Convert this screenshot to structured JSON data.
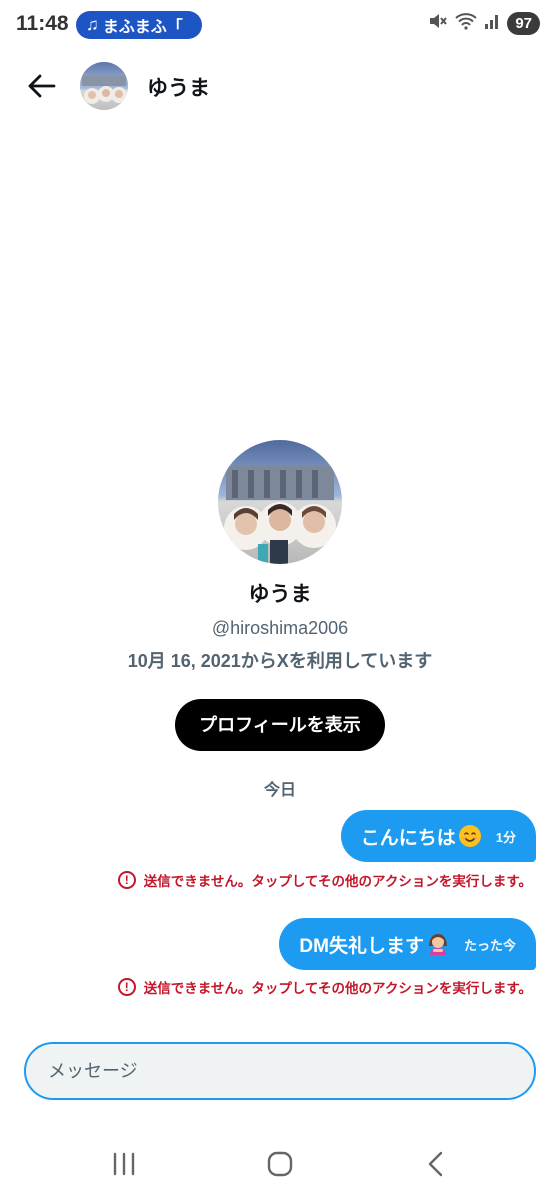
{
  "status_bar": {
    "time": "11:48",
    "media_label": "まふまふ「",
    "battery": "97",
    "icons": [
      "music-note-icon",
      "mute-icon",
      "wifi-icon",
      "signal-icon"
    ]
  },
  "header": {
    "contact_name": "ゆうま",
    "back_icon": "arrow-left-icon"
  },
  "profile": {
    "name": "ゆうま",
    "handle": "@hiroshima2006",
    "joined": "10月 16, 2021からXを利用しています",
    "view_profile_label": "プロフィールを表示"
  },
  "conversation": {
    "date_label": "今日",
    "messages": [
      {
        "text": "こんにちは",
        "emoji": "smiling-face-emoji",
        "time": "1分",
        "error": "送信できません。タップしてその他のアクションを実行します。"
      },
      {
        "text": "DM失礼します",
        "emoji": "bowing-girl-emoji",
        "time": "たった今",
        "error": "送信できません。タップしてその他のアクションを実行します。"
      }
    ]
  },
  "composer": {
    "placeholder": "メッセージ"
  },
  "colors": {
    "accent": "#1d9bf0",
    "error": "#c4162a",
    "secondary_text": "#536471",
    "button_dark": "#000000"
  },
  "nav": {
    "items": [
      "recent-apps-icon",
      "home-icon",
      "back-icon"
    ]
  }
}
